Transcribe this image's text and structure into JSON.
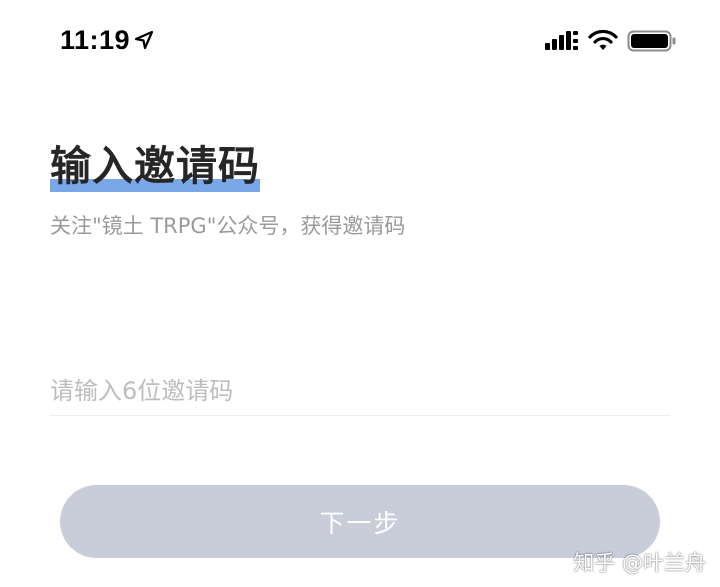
{
  "status_bar": {
    "time": "11:19",
    "location_icon": "location-arrow-icon",
    "signal_icon": "cellular-signal-icon",
    "wifi_icon": "wifi-icon",
    "battery_icon": "battery-icon"
  },
  "main": {
    "title": "输入邀请码",
    "subtitle": "关注\"镜土 TRPG\"公众号，获得邀请码",
    "input_placeholder": "请输入6位邀请码",
    "input_value": "",
    "next_button_label": "下一步"
  },
  "watermark": {
    "text": "知乎 @叶兰舟"
  },
  "colors": {
    "title_underline": "#7aa7e8",
    "button_disabled_bg": "#c9ccd9",
    "subtitle_text": "#9a9a9a",
    "placeholder_text": "#bdbdbd"
  }
}
